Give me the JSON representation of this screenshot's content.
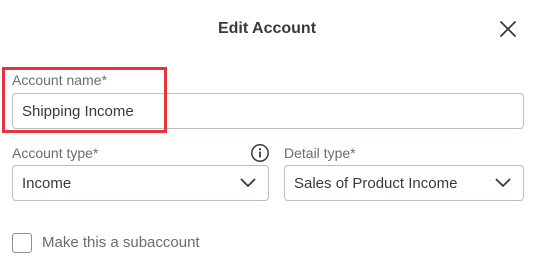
{
  "dialog": {
    "title": "Edit Account",
    "close_icon": "close-icon"
  },
  "account_name": {
    "label": "Account name*",
    "value": "Shipping Income"
  },
  "account_type": {
    "label": "Account type*",
    "selected": "Income",
    "info_icon": "info-icon"
  },
  "detail_type": {
    "label": "Detail type*",
    "selected": "Sales of Product Income"
  },
  "subaccount": {
    "label": "Make this a subaccount",
    "checked": false
  },
  "colors": {
    "highlight": "#e3353b",
    "text": "#393a3d",
    "label": "#6b6c72",
    "border": "#babec5"
  }
}
